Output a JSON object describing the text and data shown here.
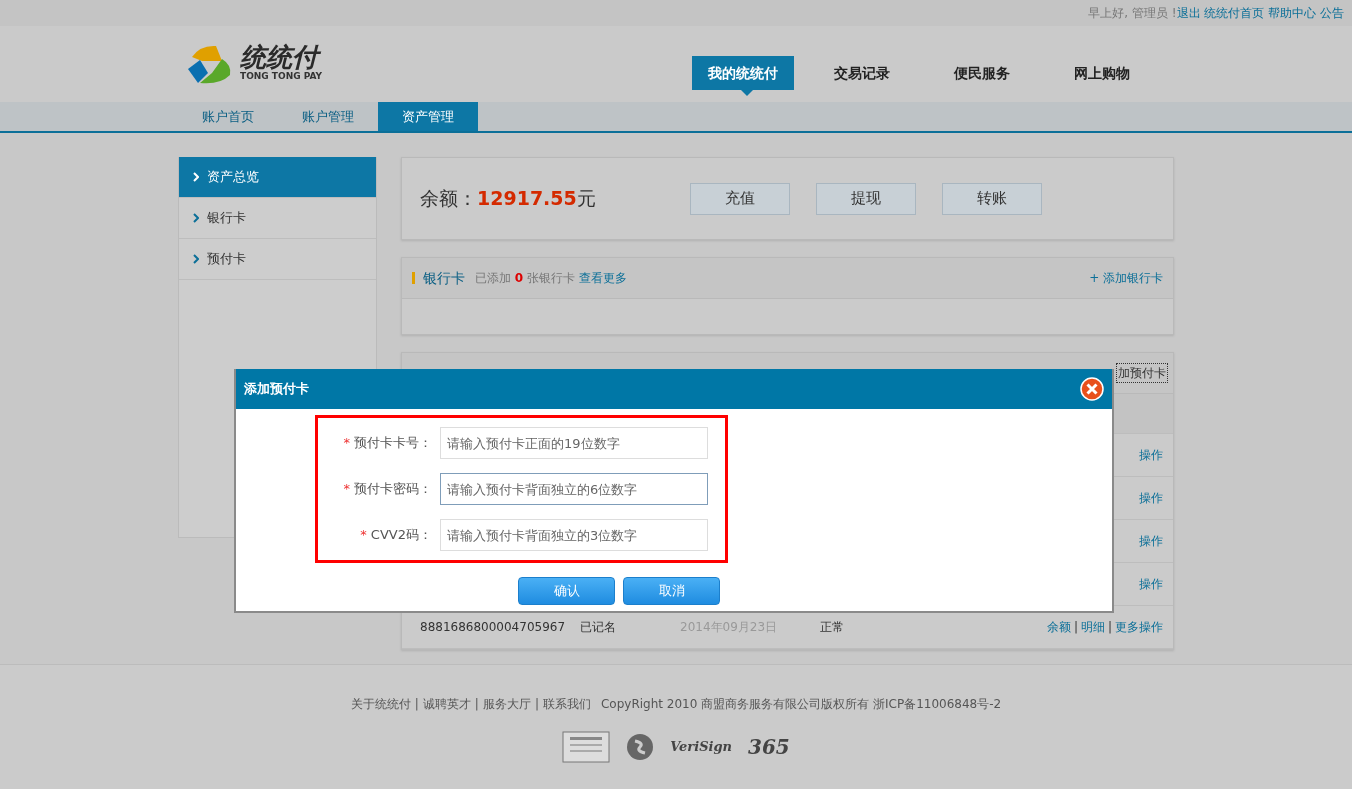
{
  "top_bar": {
    "greeting": "早上好, 管理员 !",
    "links": [
      "退出",
      "统统付首页",
      "帮助中心",
      "公告"
    ]
  },
  "logo": {
    "name": "统统付",
    "tagline": "TONG TONG PAY"
  },
  "main_nav": [
    {
      "label": "我的统统付",
      "selected": true
    },
    {
      "label": "交易记录",
      "selected": false
    },
    {
      "label": "便民服务",
      "selected": false
    },
    {
      "label": "网上购物",
      "selected": false
    }
  ],
  "sub_nav": [
    {
      "label": "账户首页",
      "selected": false
    },
    {
      "label": "账户管理",
      "selected": false
    },
    {
      "label": "资产管理",
      "selected": true
    }
  ],
  "sidebar": {
    "items": [
      {
        "label": "资产总览",
        "selected": true
      },
      {
        "label": "银行卡",
        "selected": false
      },
      {
        "label": "预付卡",
        "selected": false
      }
    ]
  },
  "balance": {
    "label": "余额：",
    "amount": "12917.55",
    "unit": "元",
    "buttons": [
      "充值",
      "提现",
      "转账"
    ]
  },
  "bank_cards": {
    "title": "银行卡",
    "summary": "已添加 **0** 张银行卡",
    "more_link": "查看更多",
    "add_link": "+ 添加银行卡"
  },
  "prepaid_cards": {
    "add_link": "加预付卡",
    "rows": [
      {
        "kind": "covered",
        "action": "操作"
      },
      {
        "kind": "covered",
        "action": "操作"
      },
      {
        "kind": "covered",
        "action": "操作"
      },
      {
        "kind": "covered",
        "action": "操作"
      },
      {
        "kind": "full",
        "card_no": "8881686800004705967",
        "registration": "已记名",
        "date": "2014年09月23日",
        "status": "正常",
        "actions": [
          "余额",
          "明细",
          "更多操作"
        ],
        "separator": "|"
      }
    ]
  },
  "dialog": {
    "title": "添加预付卡",
    "fields": [
      {
        "label": "预付卡卡号：",
        "placeholder": "请输入预付卡正面的19位数字",
        "required_mark": "*",
        "focused": false
      },
      {
        "label": "预付卡密码：",
        "placeholder": "请输入预付卡背面独立的6位数字",
        "required_mark": "*",
        "focused": true
      },
      {
        "label": "CVV2码：",
        "placeholder": "请输入预付卡背面独立的3位数字",
        "required_mark": "*",
        "focused": false
      }
    ],
    "buttons": [
      "确认",
      "取消"
    ]
  },
  "footer": {
    "links": [
      "关于统统付",
      "诚聘英才",
      "服务大厅",
      "联系我们"
    ],
    "separator": "|",
    "copyright": "CopyRight 2010 商盟商务服务有限公司版权所有 浙ICP备11006848号-2",
    "badges": [
      {
        "kind": "certificate"
      },
      {
        "kind": "seal"
      },
      {
        "kind": "text",
        "text": "VeriSign"
      },
      {
        "kind": "text",
        "text": "365"
      }
    ]
  }
}
